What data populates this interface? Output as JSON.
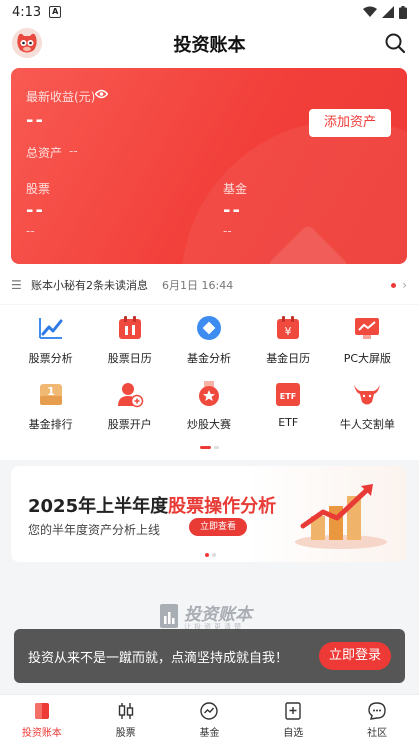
{
  "status_bar": {
    "time": "4:13",
    "notif_glyph": "A"
  },
  "header": {
    "title": "投资账本",
    "avatar_icon": "mascot-avatar-icon",
    "search_icon": "search-icon"
  },
  "hero": {
    "latest_label": "最新收益(元)",
    "latest_value": "--",
    "total_label": "总资产",
    "total_value": "--",
    "add_button": "添加资产",
    "stock_label": "股票",
    "stock_value": "--",
    "stock_sub": "--",
    "fund_label": "基金",
    "fund_value": "--",
    "fund_sub": "--",
    "accent": "#ee3a36"
  },
  "message": {
    "text": "账本小秘有2条未读消息",
    "time": "6月1日 16:44"
  },
  "menu": [
    {
      "label": "股票分析",
      "icon": "chart-trend-icon"
    },
    {
      "label": "股票日历",
      "icon": "stock-calendar-icon"
    },
    {
      "label": "基金分析",
      "icon": "fund-diamond-icon"
    },
    {
      "label": "基金日历",
      "icon": "fund-calendar-icon"
    },
    {
      "label": "PC大屏版",
      "icon": "pc-screen-icon"
    },
    {
      "label": "基金排行",
      "icon": "ranking-icon"
    },
    {
      "label": "股票开户",
      "icon": "open-account-icon"
    },
    {
      "label": "炒股大赛",
      "icon": "medal-icon"
    },
    {
      "label": "ETF",
      "icon": "etf-icon"
    },
    {
      "label": "牛人交割单",
      "icon": "bull-icon"
    }
  ],
  "banner": {
    "title_part1": "2025年上半年度",
    "title_part2": "股票操作分析",
    "subtitle": "您的半年度资产分析上线",
    "button": "立即查看"
  },
  "watermark": {
    "title": "投资账本",
    "subtitle": "让投资更清楚"
  },
  "toast": {
    "text": "投资从来不是一蹴而就，点滴坚持成就自我！",
    "button": "立即登录"
  },
  "tabs": [
    {
      "label": "投资账本",
      "icon": "ledger-icon",
      "active": true
    },
    {
      "label": "股票",
      "icon": "candlestick-icon",
      "active": false
    },
    {
      "label": "基金",
      "icon": "fund-icon",
      "active": false
    },
    {
      "label": "自选",
      "icon": "watchlist-icon",
      "active": false
    },
    {
      "label": "社区",
      "icon": "community-icon",
      "active": false
    }
  ]
}
